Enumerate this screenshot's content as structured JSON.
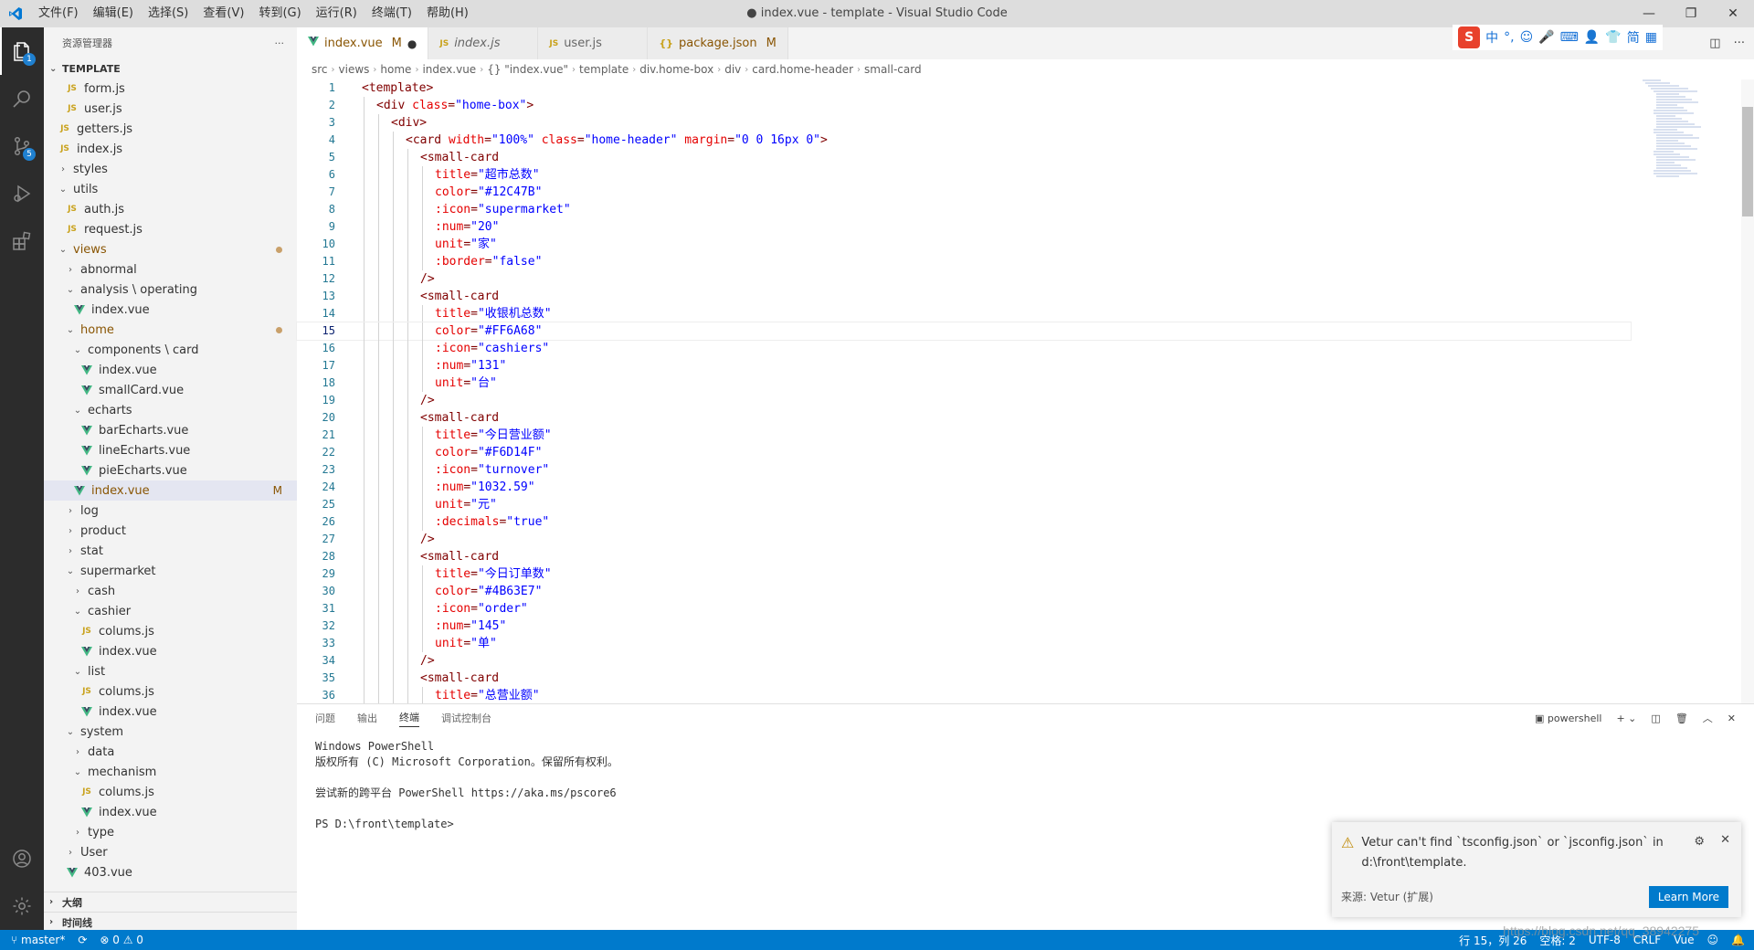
{
  "window": {
    "title": "● index.vue - template - Visual Studio Code",
    "menu": [
      "文件(F)",
      "编辑(E)",
      "选择(S)",
      "查看(V)",
      "转到(G)",
      "运行(R)",
      "终端(T)",
      "帮助(H)"
    ],
    "controls": [
      "—",
      "❐",
      "✕"
    ]
  },
  "ime": {
    "logo": "S",
    "items": [
      "中",
      "°,",
      "☺",
      "🎤",
      "⌨",
      "👤",
      "👕",
      "简",
      "▦"
    ]
  },
  "activity": {
    "explorer_badge": "1",
    "scm_badge": "5"
  },
  "sidebar": {
    "header": "资源管理器",
    "more": "···",
    "section": "TEMPLATE",
    "tree": [
      {
        "label": "form.js",
        "type": "js",
        "depth": 3
      },
      {
        "label": "user.js",
        "type": "js",
        "depth": 3
      },
      {
        "label": "getters.js",
        "type": "js",
        "depth": 2
      },
      {
        "label": "index.js",
        "type": "js",
        "depth": 2
      },
      {
        "label": "styles",
        "type": "folder-closed",
        "depth": 2
      },
      {
        "label": "utils",
        "type": "folder-open",
        "depth": 2
      },
      {
        "label": "auth.js",
        "type": "js",
        "depth": 3
      },
      {
        "label": "request.js",
        "type": "js",
        "depth": 3
      },
      {
        "label": "views",
        "type": "folder-open",
        "depth": 2,
        "modified": true,
        "dot": true
      },
      {
        "label": "abnormal",
        "type": "folder-closed",
        "depth": 3
      },
      {
        "label": "analysis \\ operating",
        "type": "folder-open",
        "depth": 3
      },
      {
        "label": "index.vue",
        "type": "vue",
        "depth": 4
      },
      {
        "label": "home",
        "type": "folder-open",
        "depth": 3,
        "modified": true,
        "dot": true
      },
      {
        "label": "components \\ card",
        "type": "folder-open",
        "depth": 4
      },
      {
        "label": "index.vue",
        "type": "vue",
        "depth": 5
      },
      {
        "label": "smallCard.vue",
        "type": "vue",
        "depth": 5
      },
      {
        "label": "echarts",
        "type": "folder-open",
        "depth": 4
      },
      {
        "label": "barEcharts.vue",
        "type": "vue",
        "depth": 5
      },
      {
        "label": "lineEcharts.vue",
        "type": "vue",
        "depth": 5
      },
      {
        "label": "pieEcharts.vue",
        "type": "vue",
        "depth": 5
      },
      {
        "label": "index.vue",
        "type": "vue",
        "depth": 4,
        "modified": true,
        "flag": "M",
        "selected": true
      },
      {
        "label": "log",
        "type": "folder-closed",
        "depth": 3
      },
      {
        "label": "product",
        "type": "folder-closed",
        "depth": 3
      },
      {
        "label": "stat",
        "type": "folder-closed",
        "depth": 3
      },
      {
        "label": "supermarket",
        "type": "folder-open",
        "depth": 3
      },
      {
        "label": "cash",
        "type": "folder-closed",
        "depth": 4
      },
      {
        "label": "cashier",
        "type": "folder-open",
        "depth": 4
      },
      {
        "label": "colums.js",
        "type": "js",
        "depth": 5
      },
      {
        "label": "index.vue",
        "type": "vue",
        "depth": 5
      },
      {
        "label": "list",
        "type": "folder-open",
        "depth": 4
      },
      {
        "label": "colums.js",
        "type": "js",
        "depth": 5
      },
      {
        "label": "index.vue",
        "type": "vue",
        "depth": 5
      },
      {
        "label": "system",
        "type": "folder-open",
        "depth": 3
      },
      {
        "label": "data",
        "type": "folder-closed",
        "depth": 4
      },
      {
        "label": "mechanism",
        "type": "folder-open",
        "depth": 4
      },
      {
        "label": "colums.js",
        "type": "js",
        "depth": 5
      },
      {
        "label": "index.vue",
        "type": "vue",
        "depth": 5
      },
      {
        "label": "type",
        "type": "folder-closed",
        "depth": 4
      },
      {
        "label": "User",
        "type": "folder-closed",
        "depth": 3
      },
      {
        "label": "403.vue",
        "type": "vue",
        "depth": 3
      }
    ],
    "outline": "大纲",
    "timeline": "时间线"
  },
  "tabs": [
    {
      "label": "index.vue",
      "icon": "vue",
      "flag": "M",
      "dirty": "●",
      "active": true
    },
    {
      "label": "index.js",
      "icon": "js",
      "italic": true
    },
    {
      "label": "user.js",
      "icon": "js"
    },
    {
      "label": "package.json",
      "icon": "json",
      "flag": "M"
    }
  ],
  "breadcrumb": [
    "src",
    "views",
    "home",
    "index.vue",
    "{} \"index.vue\"",
    "template",
    "div.home-box",
    "div",
    "card.home-header",
    "small-card"
  ],
  "code": [
    {
      "n": "1",
      "indent": 0,
      "tokens": [
        [
          "tg",
          "<template>"
        ]
      ]
    },
    {
      "n": "2",
      "indent": 1,
      "tokens": [
        [
          "tg",
          "<div "
        ],
        [
          "at",
          "class"
        ],
        [
          "pu",
          "="
        ],
        [
          "st",
          "\"home-box\""
        ],
        [
          "tg",
          ">"
        ]
      ]
    },
    {
      "n": "3",
      "indent": 2,
      "tokens": [
        [
          "tg",
          "<div>"
        ]
      ]
    },
    {
      "n": "4",
      "indent": 3,
      "tokens": [
        [
          "tg",
          "<card "
        ],
        [
          "at",
          "width"
        ],
        [
          "pu",
          "="
        ],
        [
          "st",
          "\"100%\""
        ],
        [
          "pu",
          " "
        ],
        [
          "at",
          "class"
        ],
        [
          "pu",
          "="
        ],
        [
          "st",
          "\"home-header\""
        ],
        [
          "pu",
          " "
        ],
        [
          "at",
          "margin"
        ],
        [
          "pu",
          "="
        ],
        [
          "st",
          "\"0 0 16px 0\""
        ],
        [
          "tg",
          ">"
        ]
      ]
    },
    {
      "n": "5",
      "indent": 4,
      "tokens": [
        [
          "tg",
          "<small-card"
        ]
      ]
    },
    {
      "n": "6",
      "indent": 5,
      "tokens": [
        [
          "at",
          "title"
        ],
        [
          "pu",
          "="
        ],
        [
          "st",
          "\"超市总数\""
        ]
      ]
    },
    {
      "n": "7",
      "indent": 5,
      "tokens": [
        [
          "at",
          "color"
        ],
        [
          "pu",
          "="
        ],
        [
          "st",
          "\"#12C47B\""
        ]
      ]
    },
    {
      "n": "8",
      "indent": 5,
      "tokens": [
        [
          "at",
          ":icon"
        ],
        [
          "pu",
          "="
        ],
        [
          "st",
          "\"supermarket\""
        ]
      ]
    },
    {
      "n": "9",
      "indent": 5,
      "tokens": [
        [
          "at",
          ":num"
        ],
        [
          "pu",
          "="
        ],
        [
          "st",
          "\"20\""
        ]
      ]
    },
    {
      "n": "10",
      "indent": 5,
      "tokens": [
        [
          "at",
          "unit"
        ],
        [
          "pu",
          "="
        ],
        [
          "st",
          "\"家\""
        ]
      ]
    },
    {
      "n": "11",
      "indent": 5,
      "tokens": [
        [
          "at",
          ":border"
        ],
        [
          "pu",
          "="
        ],
        [
          "st",
          "\"false\""
        ]
      ]
    },
    {
      "n": "12",
      "indent": 4,
      "tokens": [
        [
          "tg",
          "/>"
        ]
      ]
    },
    {
      "n": "13",
      "indent": 4,
      "tokens": [
        [
          "tg",
          "<small-card"
        ]
      ]
    },
    {
      "n": "14",
      "indent": 5,
      "tokens": [
        [
          "at",
          "title"
        ],
        [
          "pu",
          "="
        ],
        [
          "st",
          "\"收银机总数\""
        ]
      ]
    },
    {
      "n": "15",
      "indent": 5,
      "tokens": [
        [
          "at",
          "color"
        ],
        [
          "pu",
          "="
        ],
        [
          "st",
          "\"#FF6A68\""
        ]
      ],
      "current": true
    },
    {
      "n": "16",
      "indent": 5,
      "tokens": [
        [
          "at",
          ":icon"
        ],
        [
          "pu",
          "="
        ],
        [
          "st",
          "\"cashiers\""
        ]
      ]
    },
    {
      "n": "17",
      "indent": 5,
      "tokens": [
        [
          "at",
          ":num"
        ],
        [
          "pu",
          "="
        ],
        [
          "st",
          "\"131\""
        ]
      ]
    },
    {
      "n": "18",
      "indent": 5,
      "tokens": [
        [
          "at",
          "unit"
        ],
        [
          "pu",
          "="
        ],
        [
          "st",
          "\"台\""
        ]
      ]
    },
    {
      "n": "19",
      "indent": 4,
      "tokens": [
        [
          "tg",
          "/>"
        ]
      ]
    },
    {
      "n": "20",
      "indent": 4,
      "tokens": [
        [
          "tg",
          "<small-card"
        ]
      ]
    },
    {
      "n": "21",
      "indent": 5,
      "tokens": [
        [
          "at",
          "title"
        ],
        [
          "pu",
          "="
        ],
        [
          "st",
          "\"今日营业额\""
        ]
      ]
    },
    {
      "n": "22",
      "indent": 5,
      "tokens": [
        [
          "at",
          "color"
        ],
        [
          "pu",
          "="
        ],
        [
          "st",
          "\"#F6D14F\""
        ]
      ]
    },
    {
      "n": "23",
      "indent": 5,
      "tokens": [
        [
          "at",
          ":icon"
        ],
        [
          "pu",
          "="
        ],
        [
          "st",
          "\"turnover\""
        ]
      ]
    },
    {
      "n": "24",
      "indent": 5,
      "tokens": [
        [
          "at",
          ":num"
        ],
        [
          "pu",
          "="
        ],
        [
          "st",
          "\"1032.59\""
        ]
      ]
    },
    {
      "n": "25",
      "indent": 5,
      "tokens": [
        [
          "at",
          "unit"
        ],
        [
          "pu",
          "="
        ],
        [
          "st",
          "\"元\""
        ]
      ]
    },
    {
      "n": "26",
      "indent": 5,
      "tokens": [
        [
          "at",
          ":decimals"
        ],
        [
          "pu",
          "="
        ],
        [
          "st",
          "\"true\""
        ]
      ]
    },
    {
      "n": "27",
      "indent": 4,
      "tokens": [
        [
          "tg",
          "/>"
        ]
      ]
    },
    {
      "n": "28",
      "indent": 4,
      "tokens": [
        [
          "tg",
          "<small-card"
        ]
      ]
    },
    {
      "n": "29",
      "indent": 5,
      "tokens": [
        [
          "at",
          "title"
        ],
        [
          "pu",
          "="
        ],
        [
          "st",
          "\"今日订单数\""
        ]
      ]
    },
    {
      "n": "30",
      "indent": 5,
      "tokens": [
        [
          "at",
          "color"
        ],
        [
          "pu",
          "="
        ],
        [
          "st",
          "\"#4B63E7\""
        ]
      ]
    },
    {
      "n": "31",
      "indent": 5,
      "tokens": [
        [
          "at",
          ":icon"
        ],
        [
          "pu",
          "="
        ],
        [
          "st",
          "\"order\""
        ]
      ]
    },
    {
      "n": "32",
      "indent": 5,
      "tokens": [
        [
          "at",
          ":num"
        ],
        [
          "pu",
          "="
        ],
        [
          "st",
          "\"145\""
        ]
      ]
    },
    {
      "n": "33",
      "indent": 5,
      "tokens": [
        [
          "at",
          "unit"
        ],
        [
          "pu",
          "="
        ],
        [
          "st",
          "\"单\""
        ]
      ]
    },
    {
      "n": "34",
      "indent": 4,
      "tokens": [
        [
          "tg",
          "/>"
        ]
      ]
    },
    {
      "n": "35",
      "indent": 4,
      "tokens": [
        [
          "tg",
          "<small-card"
        ]
      ]
    },
    {
      "n": "36",
      "indent": 5,
      "tokens": [
        [
          "at",
          "title"
        ],
        [
          "pu",
          "="
        ],
        [
          "st",
          "\"总营业额\""
        ]
      ]
    }
  ],
  "panel": {
    "tabs": [
      "问题",
      "输出",
      "终端",
      "调试控制台"
    ],
    "active_tab": "终端",
    "terminal_name": "powershell",
    "terminal_lines": [
      "Windows PowerShell",
      "版权所有 (C) Microsoft Corporation。保留所有权利。",
      "",
      "尝试新的跨平台 PowerShell https://aka.ms/pscore6",
      "",
      "PS D:\\front\\template>"
    ]
  },
  "notification": {
    "message_line1": "Vetur can't find `tsconfig.json` or `jsconfig.json` in",
    "message_line2": "d:\\front\\template.",
    "source": "来源: Vetur (扩展)",
    "button": "Learn More"
  },
  "statusbar": {
    "branch": "master*",
    "problems": "⊗ 0 ⚠ 0",
    "position": "行 15，列 26",
    "spaces": "空格: 2",
    "encoding": "UTF-8",
    "eol": "CRLF",
    "language": "Vue"
  },
  "watermark": "https://blog.csdn.net/qq_38942275",
  "colors": {
    "accent": "#007acc",
    "activity": "#2c2c2c",
    "modified": "#895503"
  }
}
